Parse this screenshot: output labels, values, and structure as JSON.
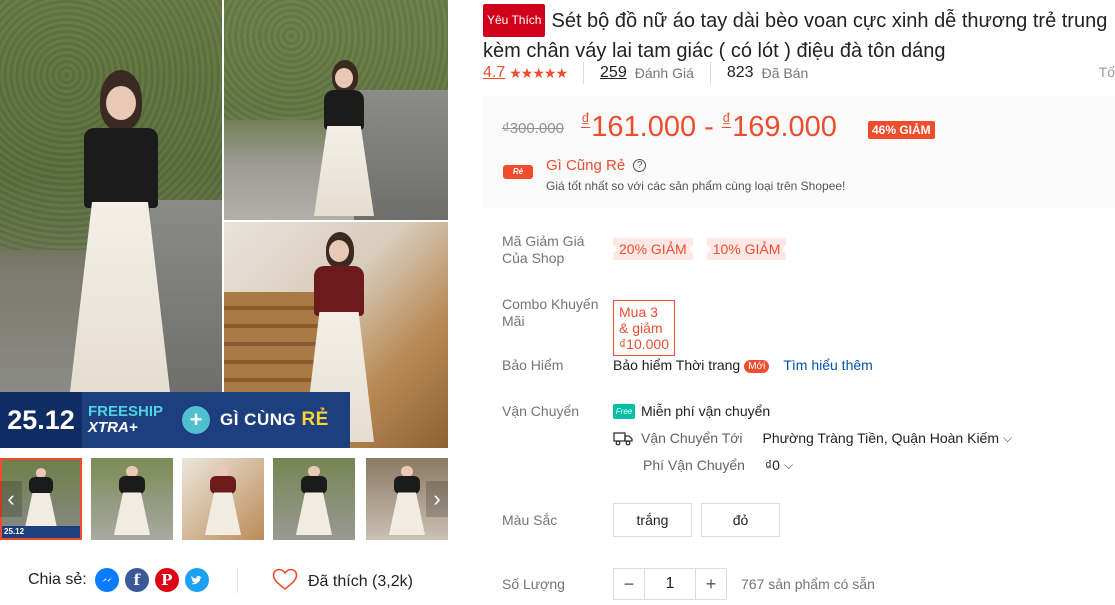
{
  "gallery": {
    "banner": {
      "date": "25.12",
      "freeship_line1": "FREESHIP",
      "freeship_line2": "XTRA+",
      "plus": "+",
      "gi_cung": "GÌ CÙNG ",
      "re": "RẺ"
    },
    "thumbnails": [
      {
        "name": "thumb-1",
        "active": true
      },
      {
        "name": "thumb-2",
        "active": false
      },
      {
        "name": "thumb-3",
        "active": false
      },
      {
        "name": "thumb-4",
        "active": false
      },
      {
        "name": "thumb-5",
        "active": false
      }
    ],
    "thumb_banner_date": "25.12",
    "prev_arrow": "‹",
    "next_arrow": "›"
  },
  "share": {
    "label": "Chia sẻ:",
    "icons": [
      "messenger-icon",
      "facebook-icon",
      "pinterest-icon",
      "twitter-icon"
    ],
    "facebook_glyph": "f",
    "pinterest_glyph": "P",
    "twitter_glyph": "t"
  },
  "like": {
    "label": "Đã thích (3,2k)"
  },
  "product": {
    "badge": "Yêu Thích",
    "title_line1": "Sét bộ đồ nữ áo tay dài bèo voan cực xinh dễ thương trẻ trung",
    "title_line2": "kèm chân váy lai tam giác ( có lót ) điệu đà tôn dáng",
    "rating": "4.7",
    "stars": "★★★★★",
    "reviews_count": "259",
    "reviews_label": "Đánh Giá",
    "sold_count": "823",
    "sold_label": "Đã Bán",
    "report_text": "Tố"
  },
  "price": {
    "original": "₫300.000",
    "currency": "₫",
    "min": "161.000",
    "separator": " - ",
    "max": "169.000",
    "discount": "46% GIẢM",
    "cheap_badge": "Rẻ",
    "cheap_title": "Gì Cũng Rẻ",
    "cheap_help": "?",
    "cheap_desc": "Giá tốt nhất so với các sản phẩm cùng loại trên Shopee!"
  },
  "vouchers": {
    "label": "Mã Giảm Giá Của Shop",
    "items": [
      "20% GIẢM",
      "10% GIẢM"
    ]
  },
  "combo": {
    "label": "Combo Khuyến Mãi",
    "text": "Mua 3 & giảm ₫10.000"
  },
  "insurance": {
    "label": "Bảo Hiểm",
    "text": "Bảo hiểm Thời trang",
    "new_badge": "Mới",
    "link": "Tìm hiểu thêm"
  },
  "shipping": {
    "label": "Vận Chuyển",
    "free_badge": "Free",
    "free_text": "Miễn phí vận chuyển",
    "to_label": "Vận Chuyển Tới",
    "to_value": "Phường Tràng Tiền, Quận Hoàn Kiếm",
    "fee_label": "Phí Vận Chuyển",
    "fee_value": "₫0",
    "chevron": "⌵"
  },
  "color": {
    "label": "Màu Sắc",
    "options": [
      "trắng",
      "đỏ"
    ]
  },
  "quantity": {
    "label": "Số Lượng",
    "minus": "−",
    "value": "1",
    "plus": "+",
    "stock": "767 sản phẩm có sẵn"
  },
  "colors": {
    "accent": "#ee4d2d",
    "fav_badge": "#d0011b",
    "link": "#0055aa",
    "free_ship": "#00bfa5"
  }
}
